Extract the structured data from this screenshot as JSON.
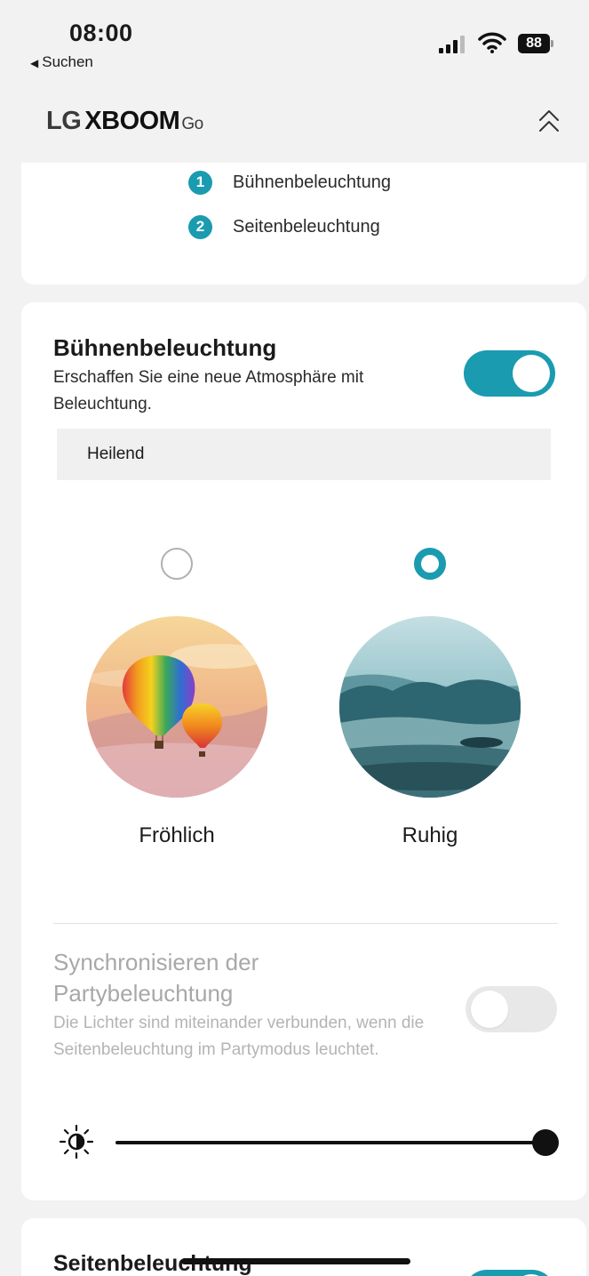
{
  "status_bar": {
    "time": "08:00",
    "back_label": "Suchen",
    "battery": "88"
  },
  "header": {
    "brand": "LG",
    "product": "XBOOM",
    "suffix": "Go",
    "collapse_icon": "double-chevron-up-icon"
  },
  "legend": {
    "items": [
      {
        "number": "1",
        "label": "Bühnenbeleuchtung"
      },
      {
        "number": "2",
        "label": "Seitenbeleuchtung"
      }
    ]
  },
  "stage_lighting": {
    "title": "Bühnenbeleuchtung",
    "description": "Erschaffen Sie eine neue Atmosphäre mit Beleuchtung.",
    "enabled": true,
    "preset": "Heilend",
    "moods": [
      {
        "label": "Fröhlich",
        "selected": false,
        "image": "hot-air-balloons"
      },
      {
        "label": "Ruhig",
        "selected": true,
        "image": "misty-mountain-lake"
      }
    ],
    "accent_color": "#1a9bb0"
  },
  "party_sync": {
    "title": "Synchronisieren der Partybeleuchtung",
    "description": "Die Lichter sind miteinander verbunden, wenn die Seitenbeleuchtung im Partymodus leuchtet.",
    "enabled": false
  },
  "brightness": {
    "icon": "brightness-icon",
    "level_percent": 100
  },
  "side_lighting": {
    "title": "Seitenbeleuchtung",
    "enabled": true
  }
}
